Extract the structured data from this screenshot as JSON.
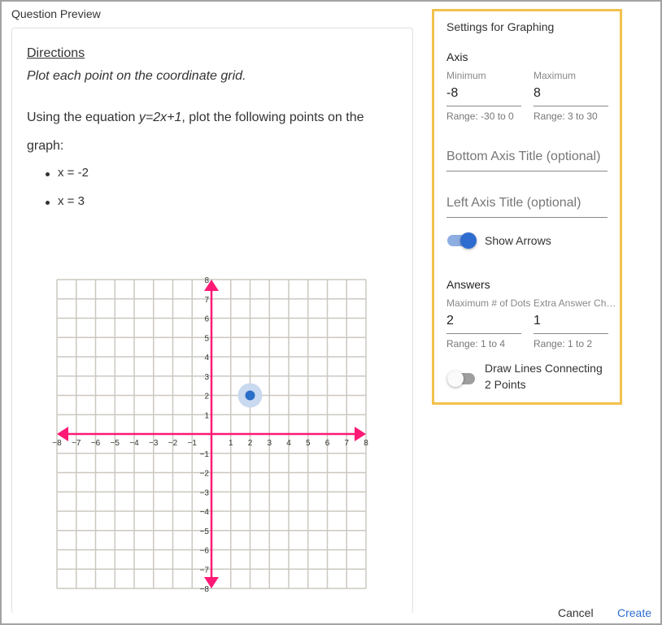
{
  "preview": {
    "title": "Question Preview",
    "directions_heading": "Directions",
    "directions_text": "Plot each point on the coordinate grid.",
    "question_prefix": "Using the equation ",
    "question_equation": "y=2x+1",
    "question_suffix": ", plot the following points on the graph:",
    "points": [
      "x = -2",
      "x = 3"
    ]
  },
  "graph": {
    "x_min": -8,
    "x_max": 8,
    "y_min": -8,
    "y_max": 8,
    "show_arrows": true,
    "plotted_points": [
      {
        "x": 2,
        "y": 2
      }
    ],
    "colors": {
      "grid": "#ccc8c0",
      "axis": "#ff1a75",
      "point": "#2a6fc9",
      "point_halo": "#c9d9ef"
    },
    "x_tick_labels": [
      "−8",
      "−7",
      "−6",
      "−5",
      "−4",
      "−3",
      "−2",
      "−1",
      "1",
      "2",
      "3",
      "4",
      "5",
      "6",
      "7",
      "8"
    ],
    "y_tick_labels": [
      "−8",
      "−7",
      "−6",
      "−5",
      "−4",
      "−3",
      "−2",
      "−1",
      "1",
      "2",
      "3",
      "4",
      "5",
      "6",
      "7",
      "8"
    ]
  },
  "settings": {
    "title": "Settings for Graphing",
    "axis_section": "Axis",
    "minimum": {
      "label": "Minimum",
      "value": "-8",
      "hint": "Range: -30 to 0"
    },
    "maximum": {
      "label": "Maximum",
      "value": "8",
      "hint": "Range: 3 to 30"
    },
    "bottom_axis_title": {
      "value": "",
      "placeholder": "Bottom Axis Title (optional)"
    },
    "left_axis_title": {
      "value": "",
      "placeholder": "Left Axis Title (optional)"
    },
    "show_arrows": {
      "label": "Show Arrows",
      "on": true
    },
    "answers_section": "Answers",
    "max_dots": {
      "label": "Maximum # of Dots",
      "value": "2",
      "hint": "Range: 1 to 4"
    },
    "extra_choices": {
      "label": "Extra Answer Choices",
      "value": "1",
      "hint": "Range: 1 to 2"
    },
    "draw_lines": {
      "label_line1": "Draw Lines Connecting",
      "label_line2": "2 Points",
      "on": false
    },
    "accent_color": "#f2c14e"
  },
  "footer": {
    "cancel_label": "Cancel",
    "create_label": "Create"
  }
}
